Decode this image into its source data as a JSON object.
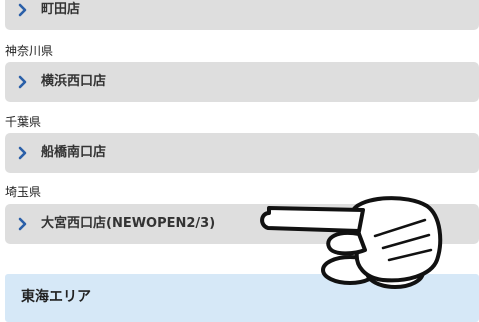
{
  "groups": [
    {
      "prefecture": "",
      "store": "町田店"
    },
    {
      "prefecture": "神奈川県",
      "store": "横浜西口店"
    },
    {
      "prefecture": "千葉県",
      "store": "船橋南口店"
    },
    {
      "prefecture": "埼玉県",
      "store": "大宮西口店(NEWOPEN2/3)"
    }
  ],
  "next_area": {
    "title": "東海エリア"
  },
  "colors": {
    "item_background": "#dedede",
    "chevron": "#2a5fa8",
    "area_background": "#d6e8f7"
  },
  "icons": {
    "chevron": "chevron-right-icon",
    "pointer": "pointing-hand-icon"
  }
}
